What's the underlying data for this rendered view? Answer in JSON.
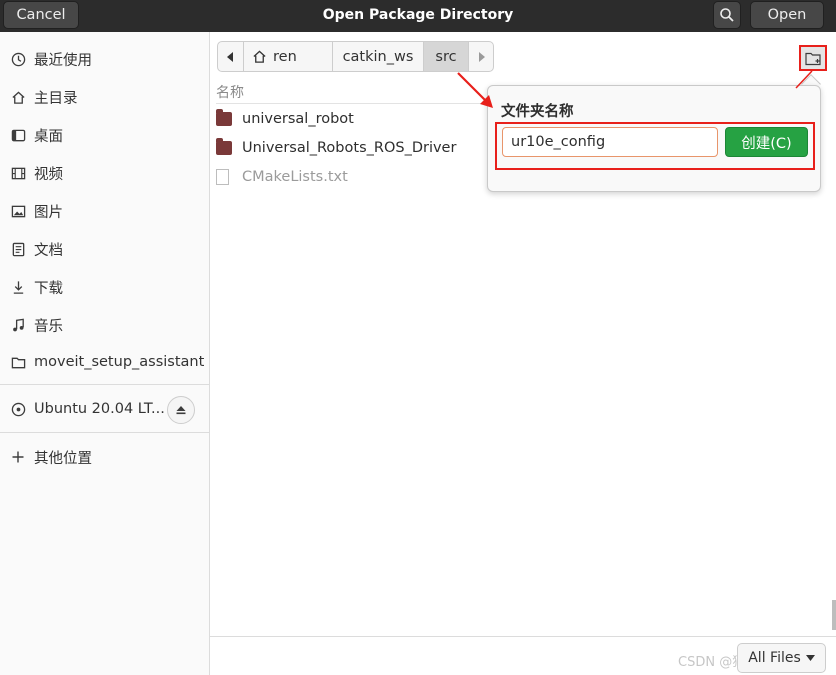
{
  "header": {
    "title": "Open Package Directory",
    "cancel_label": "Cancel",
    "open_label": "Open"
  },
  "sidebar": {
    "items": [
      {
        "label": "最近使用",
        "icon": "clock-icon"
      },
      {
        "label": "主目录",
        "icon": "home-icon"
      },
      {
        "label": "桌面",
        "icon": "desktop-icon"
      },
      {
        "label": "视频",
        "icon": "video-icon"
      },
      {
        "label": "图片",
        "icon": "image-icon"
      },
      {
        "label": "文档",
        "icon": "document-icon"
      },
      {
        "label": "下载",
        "icon": "download-icon"
      },
      {
        "label": "音乐",
        "icon": "music-icon"
      },
      {
        "label": "moveit_setup_assistant",
        "icon": "folder-icon"
      }
    ],
    "drive": {
      "label": "Ubuntu 20.04 LT...",
      "icon": "disc-icon"
    },
    "other": {
      "label": "其他位置",
      "icon": "plus-icon"
    }
  },
  "pathbar": {
    "segments": [
      "ren",
      "catkin_ws",
      "src"
    ]
  },
  "file_list": {
    "column_name": "名称",
    "rows": [
      {
        "name": "universal_robot",
        "type": "folder"
      },
      {
        "name": "Universal_Robots_ROS_Driver",
        "type": "folder"
      },
      {
        "name": "CMakeLists.txt",
        "type": "file"
      }
    ]
  },
  "new_folder_popover": {
    "label": "文件夹名称",
    "input_value": "ur10e_config",
    "create_label": "创建(C)"
  },
  "filter": {
    "label": "All Files"
  },
  "watermark": "CSDN @猎人 MMMD",
  "colors": {
    "headerbar": "#2c2c2c",
    "create_button": "#26a243",
    "annotation_red": "#e8201b",
    "folder": "#7a3939"
  }
}
